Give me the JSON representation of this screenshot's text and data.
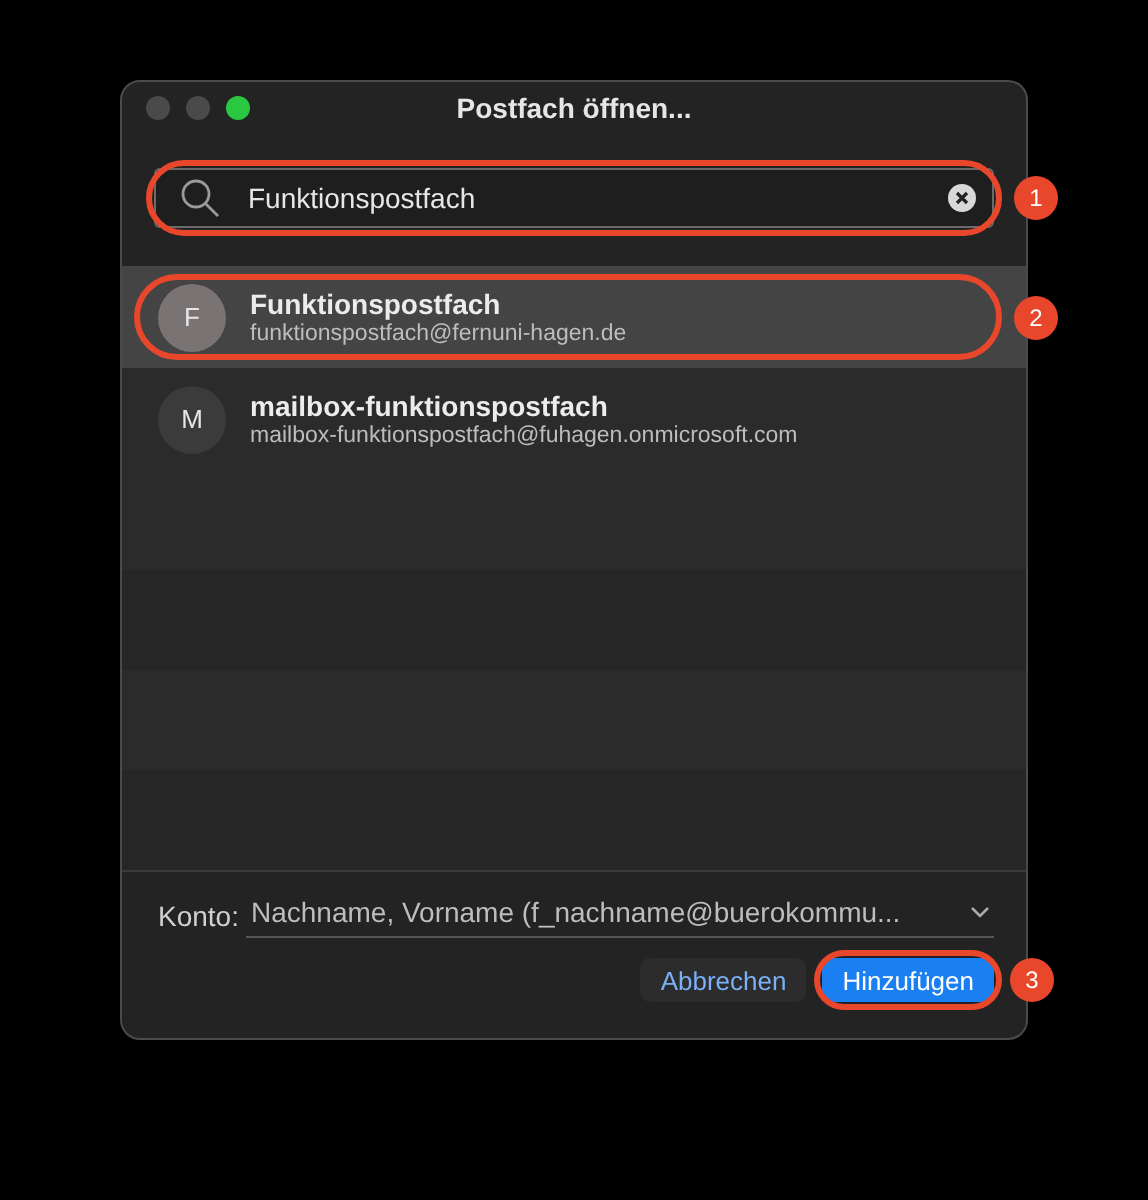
{
  "window": {
    "title": "Postfach öffnen..."
  },
  "search": {
    "value": "Funktionspostfach",
    "callout": "1"
  },
  "results": [
    {
      "initial": "F",
      "name": "Funktionspostfach",
      "email": "funktionspostfach@fernuni-hagen.de",
      "selected": true,
      "callout": "2"
    },
    {
      "initial": "M",
      "name": "mailbox-funktionspostfach",
      "email": "mailbox-funktionspostfach@fuhagen.onmicrosoft.com",
      "selected": false
    }
  ],
  "account": {
    "label": "Konto:",
    "value": "Nachname, Vorname (f_nachname@buerokommu..."
  },
  "buttons": [
    {
      "label": "Abbrechen",
      "kind": "secondary"
    },
    {
      "label": "Hinzufügen",
      "kind": "primary",
      "callout": "3"
    }
  ]
}
